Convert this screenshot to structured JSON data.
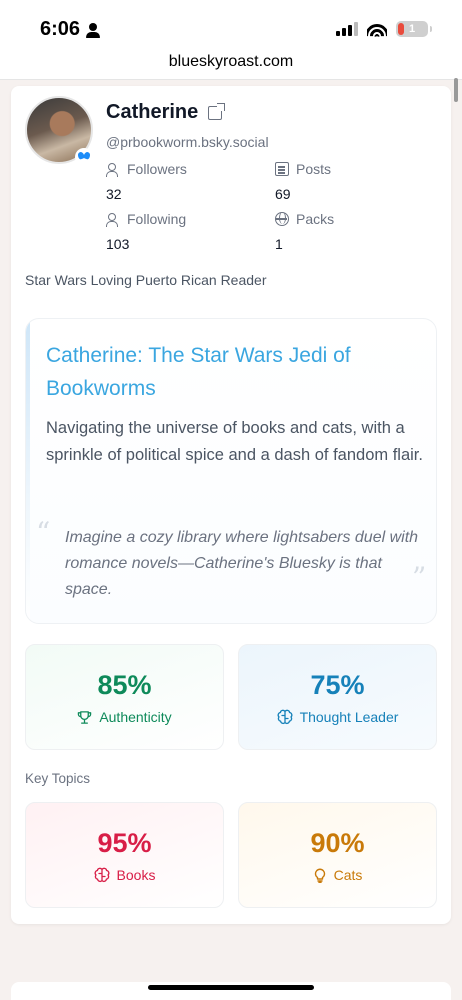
{
  "status": {
    "time": "6:06",
    "battery": "1",
    "colors": {
      "battery_fill": "#e94b3c"
    }
  },
  "browser": {
    "url": "blueskyroast.com"
  },
  "profile": {
    "name": "Catherine",
    "handle": "@prbookworm.bsky.social",
    "stats": {
      "followers_label": "Followers",
      "followers": "32",
      "posts_label": "Posts",
      "posts": "69",
      "following_label": "Following",
      "following": "103",
      "packs_label": "Packs",
      "packs": "1"
    },
    "bio": "Star Wars Loving Puerto Rican Reader"
  },
  "roast": {
    "title": "Catherine: The Star Wars Jedi of Bookworms",
    "description": "Navigating the universe of books and cats, with a sprinkle of political spice and a dash of fandom flair.",
    "quote": "Imagine a cozy library where lightsabers duel with romance novels—Catherine's Bluesky is that space."
  },
  "metrics": [
    {
      "value": "85%",
      "label": "Authenticity",
      "icon": "trophy-icon",
      "color": "#0e8a5a"
    },
    {
      "value": "75%",
      "label": "Thought Leader",
      "icon": "brain-icon",
      "color": "#1681b9"
    }
  ],
  "key_topics": {
    "heading": "Key Topics",
    "items": [
      {
        "value": "95%",
        "label": "Books",
        "icon": "brain-icon",
        "color": "#d81e47"
      },
      {
        "value": "90%",
        "label": "Cats",
        "icon": "lightbulb-icon",
        "color": "#c97a09"
      }
    ]
  },
  "colors": {
    "accent": "#3aa6e0",
    "background": "#f6f1ef"
  }
}
